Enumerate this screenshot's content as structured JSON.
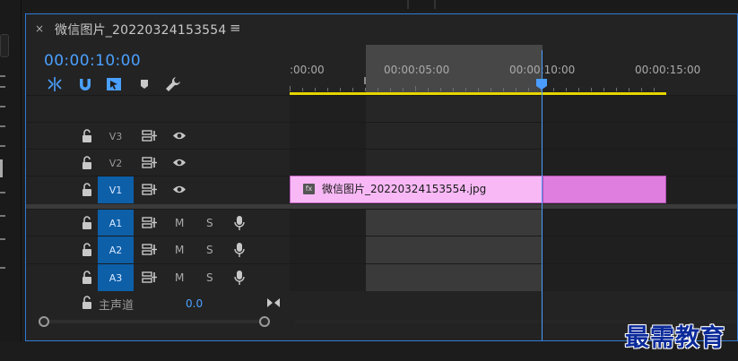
{
  "tab": {
    "close_glyph": "×",
    "title": "微信图片_20220324153554",
    "menu_glyph": "≡"
  },
  "timecode": "00:00:10:00",
  "toolbar": {
    "tools": [
      "snap-insert-icon",
      "magnet-icon",
      "linked-selection-icon",
      "marker-icon",
      "wrench-icon"
    ]
  },
  "ruler": {
    "labels": [
      ":00:00",
      "00:00:05:00",
      "00:00:10:00",
      "00:00:15:00"
    ]
  },
  "tracks": {
    "video": [
      {
        "name": "V3",
        "active": false
      },
      {
        "name": "V2",
        "active": false
      },
      {
        "name": "V1",
        "active": true
      }
    ],
    "audio": [
      {
        "name": "A1",
        "m": "M",
        "s": "S"
      },
      {
        "name": "A2",
        "m": "M",
        "s": "S"
      },
      {
        "name": "A3",
        "m": "M",
        "s": "S"
      }
    ]
  },
  "clip": {
    "fx": "fx",
    "name": "微信图片_20220324153554.jpg"
  },
  "master": {
    "label": "主声道",
    "value": "0.0"
  },
  "watermark": "最需教育",
  "colors": {
    "accent": "#4aa0ff",
    "panel_border": "#2f7bd6",
    "clip_light": "#f7b8f5",
    "clip_dark": "#e07ee0",
    "work_bar": "#e6d500",
    "active_track": "#0d5fa8"
  }
}
